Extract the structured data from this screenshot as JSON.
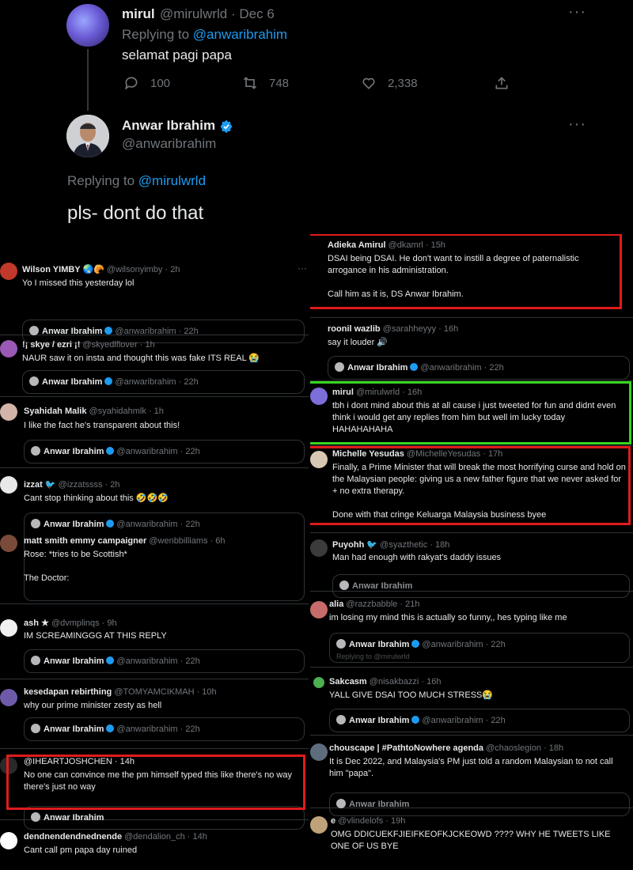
{
  "thread": {
    "tweet1": {
      "name": "mirul",
      "meta": "@mirulwrld · Dec 6",
      "replying_prefix": "Replying to ",
      "replying_handle": "@anwaribrahim",
      "text": "selamat pagi papa",
      "replies": "100",
      "retweets": "748",
      "likes": "2,338"
    },
    "tweet2": {
      "name": "Anwar Ibrahim",
      "handle": "@anwaribrahim",
      "replying_prefix": "Replying to ",
      "replying_handle": "@mirulwrld",
      "text": "pls- dont do that"
    },
    "more": "···"
  },
  "quoted": {
    "name": "Anwar Ibrahim",
    "meta": "@anwaribrahim · 22h"
  },
  "left_replies": [
    {
      "name": "Wilson YIMBY 🌏🥐",
      "meta": "@wilsonyimby · 2h",
      "text": "Yo I missed this yesterday lol",
      "color": "#c0392b"
    },
    {
      "name": "!¡ skye / ezri ¡!",
      "meta": "@skyedlflover · 1h",
      "text": "NAUR saw it on insta and thought this was fake ITS REAL 😭",
      "color": "#9b59b6"
    },
    {
      "name": "Syahidah Malik",
      "meta": "@syahidahmlk · 1h",
      "text": "I like the fact he's transparent about this!",
      "color": "#d2b4a8"
    },
    {
      "name": "izzat 🐦",
      "meta": "@izzatssss · 2h",
      "text": "Cant stop thinking about this 🤣🤣🤣",
      "color": "#e8e8e8",
      "inner": {
        "name": "matt smith emmy campaigner",
        "meta": "@wenbbilliams · 6h",
        "text": "Rose: *tries to be Scottish*\n\nThe Doctor:"
      }
    },
    {
      "name": "ash ★",
      "meta": "@dvmplinqs · 9h",
      "text": "IM SCREAMINGGG AT THIS REPLY",
      "color": "#f0f0f0"
    },
    {
      "name": "kesedapan rebirthing",
      "meta": "@TOMYAMCIKMAH · 10h",
      "text": "why our prime minister zesty as hell",
      "color": "#6e5aa8"
    },
    {
      "name": "",
      "meta": "@IHEARTJOSHCHEN · 14h",
      "text": "No one can convince me the pm himself typed this like there's no way there's just no way",
      "color": "#2a2a2a"
    },
    {
      "name": "dendnendendnednende",
      "meta": "@dendalion_ch · 14h",
      "text": "Cant call pm papa day ruined",
      "color": "#ffffff"
    }
  ],
  "right_replies": [
    {
      "name": "Adieka Amirul",
      "meta": "@dkamrl · 15h",
      "text": "DSAI being DSAI. He don't want to instill a degree of paternalistic arrogance in his administration.\n\nCall him as it is, DS Anwar Ibrahim.",
      "color": "#444"
    },
    {
      "name": "roonil wazlib",
      "meta": "@sarahheyyy · 16h",
      "text": "say it louder 🔊",
      "color": "#222"
    },
    {
      "name": "mirul",
      "meta": "@mirulwrld · 16h",
      "text": "tbh i dont mind about this at all cause i just tweeted for fun and didnt even think i would get any replies from him but well im lucky today HAHAHAHAHA",
      "color": "#7d6fd9"
    },
    {
      "name": "Michelle Yesudas",
      "meta": "@MichelleYesudas · 17h",
      "text": "Finally, a Prime Minister that will break the most horrifying curse and hold on the Malaysian people: giving us a new father figure that we never asked for + no extra therapy.\n\nDone with that cringe Keluarga Malaysia business byee",
      "color": "#d8c7b3"
    },
    {
      "name": "Puyohh 🐦",
      "meta": "@syazthetic · 18h",
      "text": "Man had enough with rakyat's daddy issues",
      "color": "#3b3b3b"
    },
    {
      "name": "alia",
      "meta": "@razzbabble · 21h",
      "text": "im losing my mind this is actually so funny,, hes typing like me",
      "color": "#c86b6b",
      "quote_sub": "Replying to @mirulwrld"
    },
    {
      "name": "Sakcasm",
      "meta": "@nisakbazzi · 16h",
      "text": "YALL GIVE DSAI TOO MUCH STRESS😭",
      "color": "#1a1a1a"
    },
    {
      "name": "chouscape | #PathtoNowhere agenda",
      "meta": "@chaoslegion · 18h",
      "text": "It is Dec 2022, and Malaysia's PM just told a random Malaysian to not call him \"papa\".",
      "color": "#5d6d7e"
    },
    {
      "name": "e",
      "meta": "@vlindelofs · 19h",
      "text": "OMG DDICUEKFJIEIFKEOFKJCKEOWD ???? WHY HE TWEETS LIKE ONE OF US BYE",
      "color": "#bfa27a"
    }
  ],
  "colors": {
    "highlight_red": "#e01b1b",
    "highlight_green": "#37d51f",
    "link": "#1d9bf0",
    "muted": "#71767b"
  }
}
